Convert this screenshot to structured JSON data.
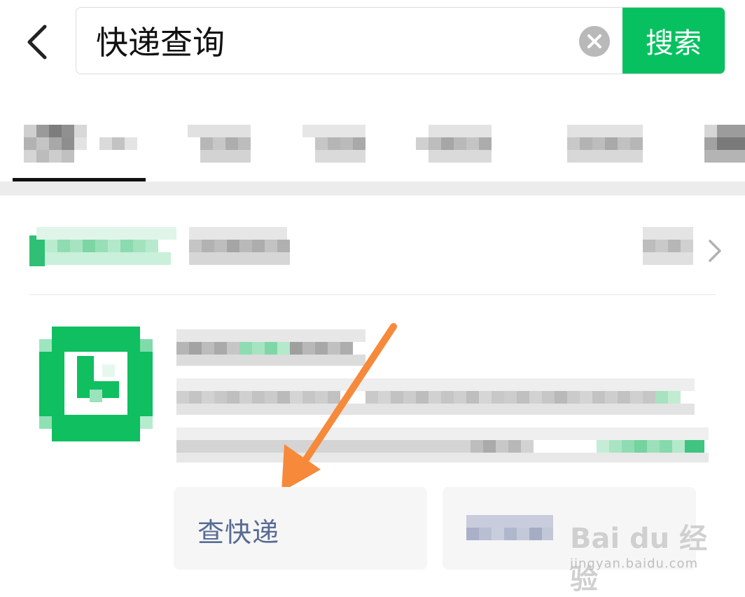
{
  "search": {
    "query": "快递查询",
    "button_label": "搜索"
  },
  "actions": {
    "card1_label": "查快递"
  },
  "watermark": {
    "brand": "Bai du 经验",
    "url": "jingyan.baidu.com"
  },
  "colors": {
    "brand_green": "#07c160",
    "link_blue": "#576b95",
    "arrow_orange": "#f7893b"
  }
}
